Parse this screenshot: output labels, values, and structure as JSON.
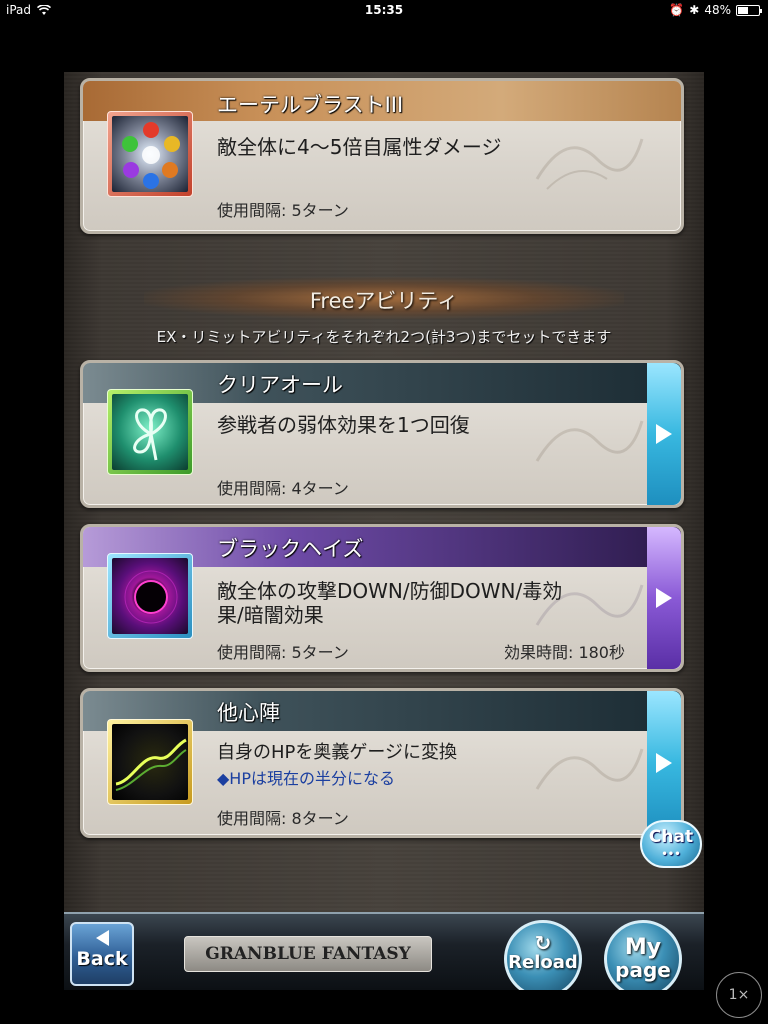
{
  "status_bar": {
    "device": "iPad",
    "time": "15:35",
    "battery_text": "48%",
    "battery_level": 0.48
  },
  "top_card": {
    "title": "エーテルブラストIII",
    "description": "敵全体に4〜5倍自属性ダメージ",
    "interval": "使用間隔: 5ターン"
  },
  "section": {
    "title": "Freeアビリティ",
    "note": "EX・リミットアビリティをそれぞれ2つ(計3つ)までセットできます"
  },
  "abilities": [
    {
      "title": "クリアオール",
      "description": "参戦者の弱体効果を1つ回復",
      "interval": "使用間隔: 4ターン",
      "color": "#38b8e0"
    },
    {
      "title": "ブラックヘイズ",
      "description_line1": "敵全体の攻撃DOWN/防御DOWN/毒効",
      "description_line2": "果/暗闇効果",
      "interval": "使用間隔: 5ターン",
      "effect_time": "効果時間: 180秒",
      "color": "#7a4fc4"
    },
    {
      "title": "他心陣",
      "description": "自身のHPを奥義ゲージに変換",
      "sub_note": "◆HPは現在の半分になる",
      "interval": "使用間隔: 8ターン",
      "color": "#38b8e0"
    }
  ],
  "footer": {
    "back_label": "Back",
    "logo_text": "GRANBLUE FANTASY",
    "reload_label": "Reload",
    "mypage_label_1": "My",
    "mypage_label_2": "page"
  },
  "chat_label": "Chat",
  "zoom_label": "1×"
}
